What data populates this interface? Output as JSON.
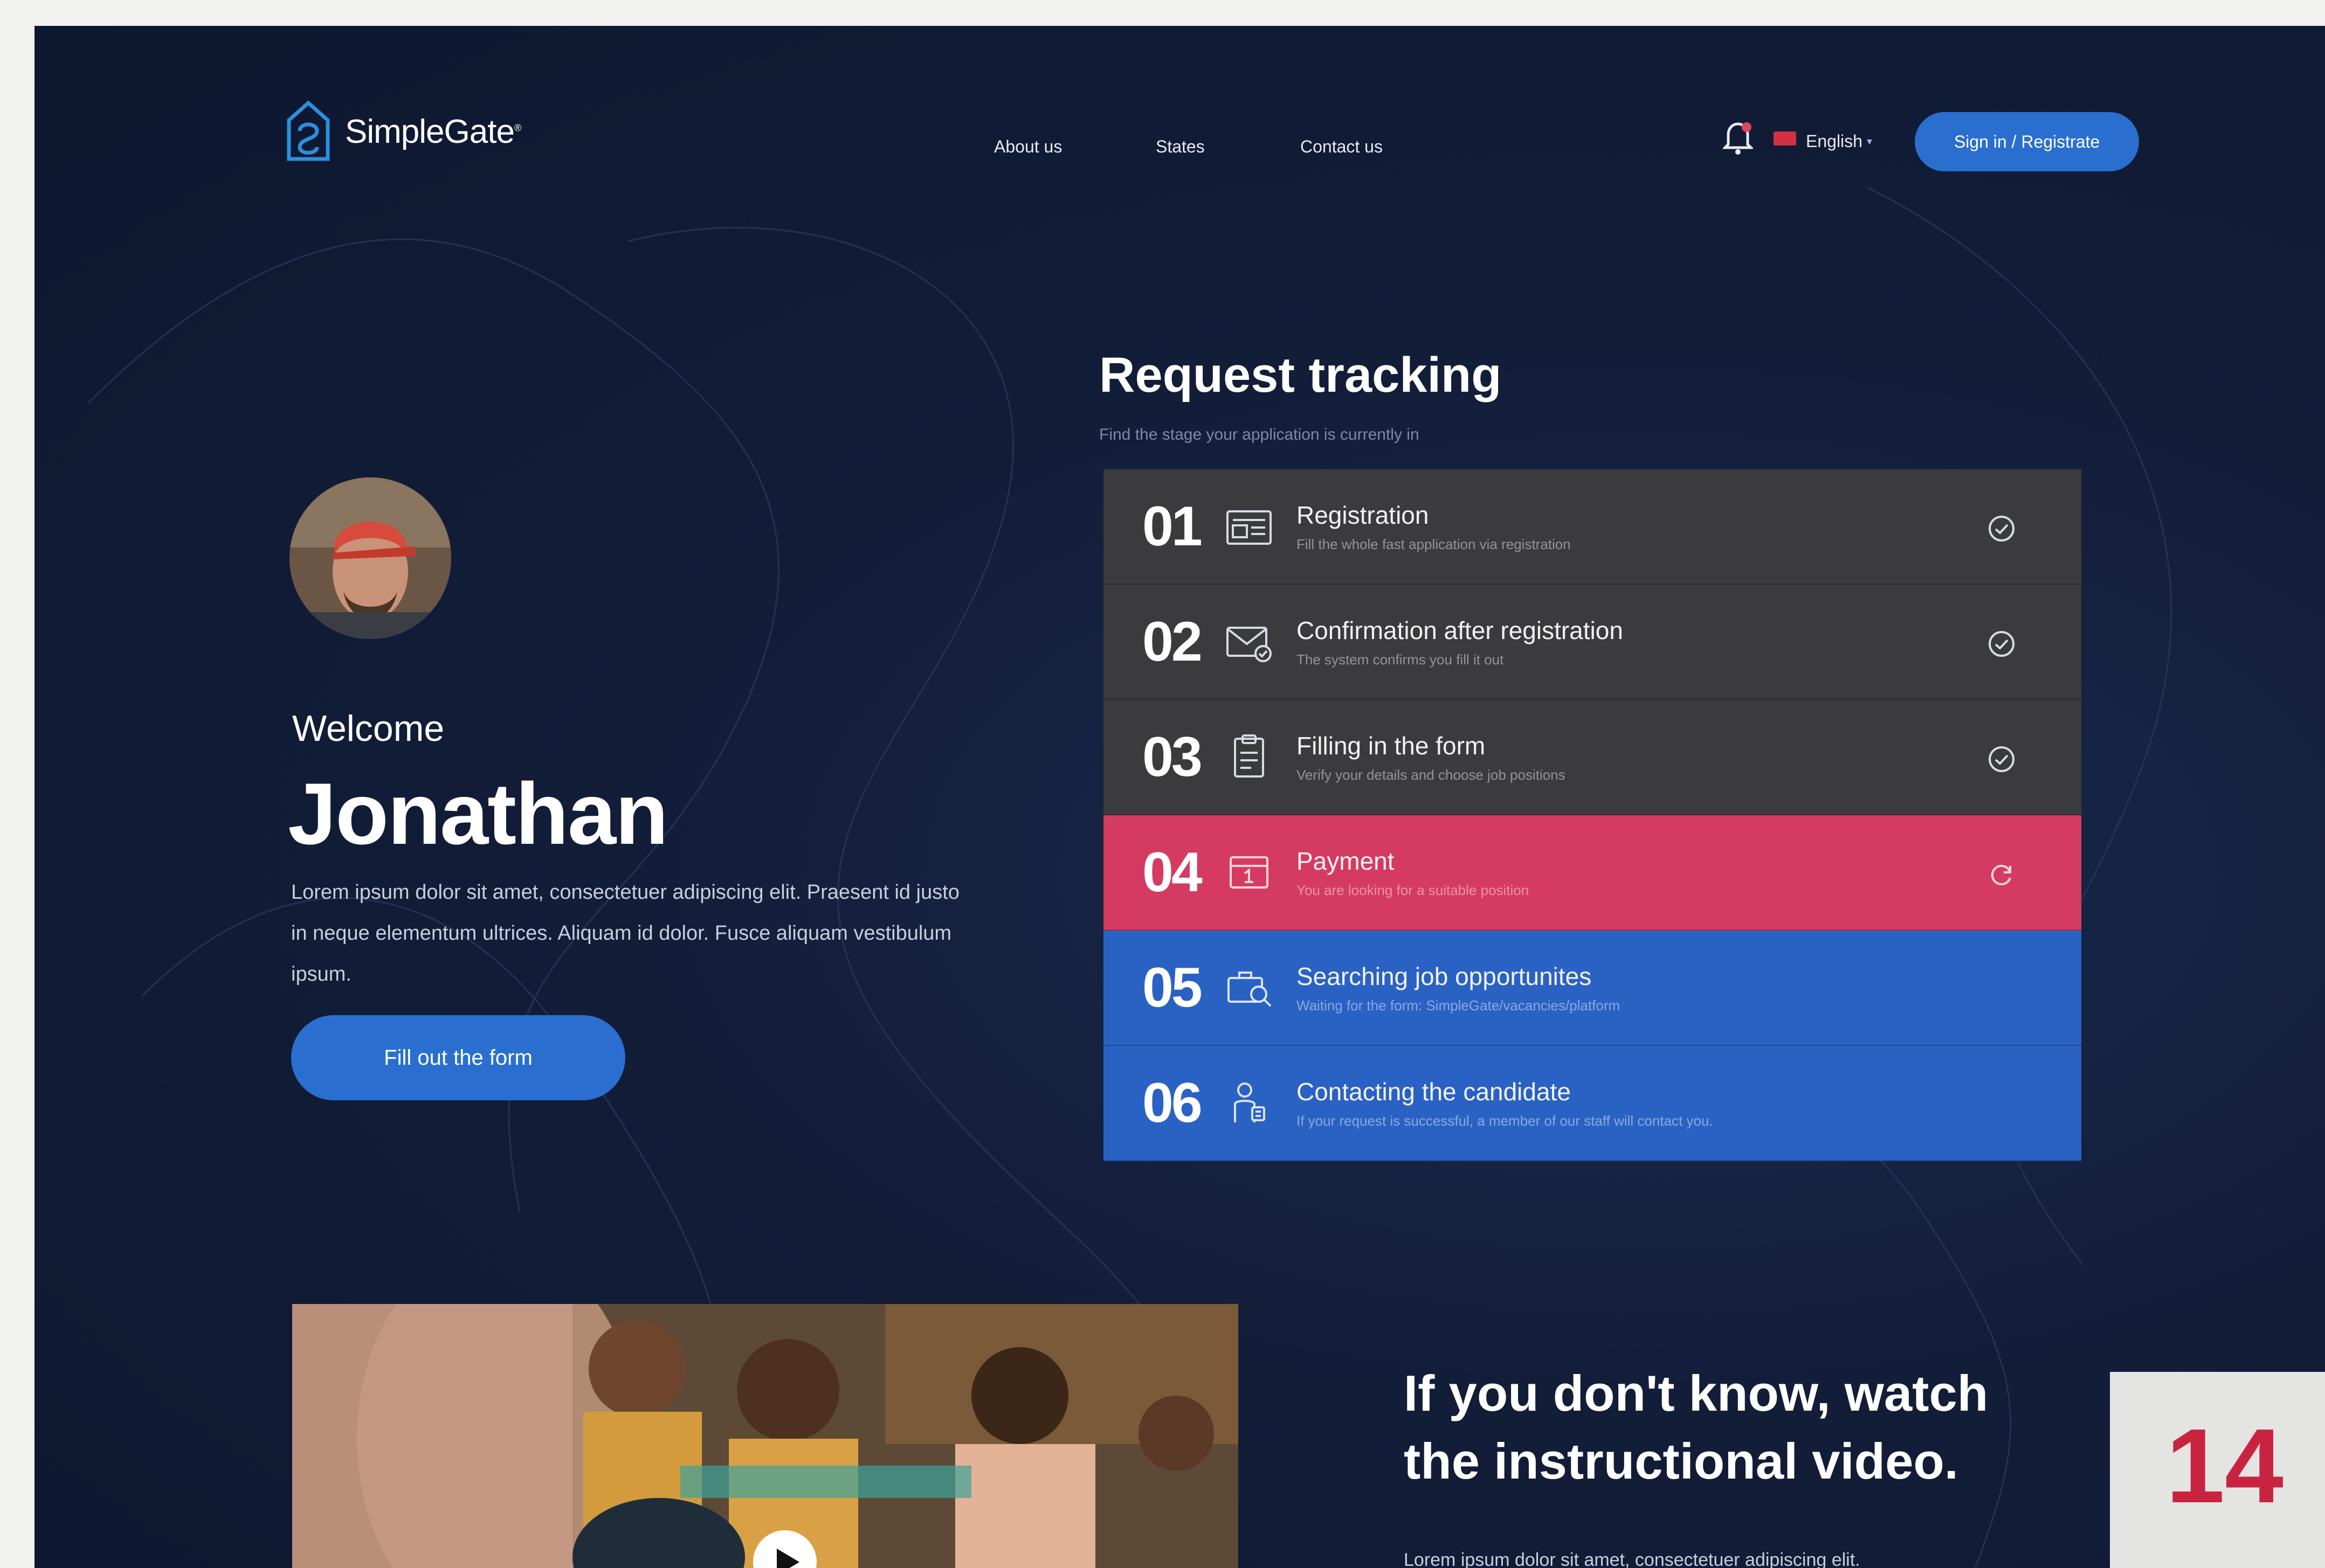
{
  "brand": {
    "name": "SimpleGate",
    "trademark": "®"
  },
  "nav": {
    "items": [
      "About us",
      "States",
      "Contact us"
    ],
    "language": "English",
    "signin_label": "Sign in / Registrate"
  },
  "hero": {
    "welcome": "Welcome",
    "username": "Jonathan",
    "intro": "Lorem ipsum dolor sit amet, consectetuer adipiscing elit. Praesent id justo in neque elementum ultrices. Aliquam id dolor. Fusce aliquam vestibulum ipsum.",
    "cta_label": "Fill out the form"
  },
  "tracking": {
    "title": "Request tracking",
    "subtitle": "Find the stage your application is currently in",
    "steps": [
      {
        "number": "01",
        "title": "Registration",
        "desc": "Fill the whole fast application via registration",
        "state": "done",
        "icon": "registration-icon"
      },
      {
        "number": "02",
        "title": "Confirmation after registration",
        "desc": "The system confirms you fill it out",
        "state": "done",
        "icon": "mail-icon"
      },
      {
        "number": "03",
        "title": "Filling in the form",
        "desc": "Verify your details and choose job positions",
        "state": "done",
        "icon": "form-icon"
      },
      {
        "number": "04",
        "title": "Payment",
        "desc": "You are looking for a suitable position",
        "state": "current",
        "icon": "payment-icon"
      },
      {
        "number": "05",
        "title": "Searching job opportunites",
        "desc": "Waiting for the form: SimpleGate/vacancies/platform",
        "state": "pending",
        "icon": "job-search-icon"
      },
      {
        "number": "06",
        "title": "Contacting the candidate",
        "desc": "If your request is successful, a member of our staff will contact you.",
        "state": "pending",
        "icon": "candidate-icon"
      }
    ],
    "colors": {
      "done": "#3b3b3d",
      "current": "#d53b62",
      "pending": "#2a62c4"
    }
  },
  "video": {
    "title": "If you don't know, watch the instructional video.",
    "body": "Lorem ipsum dolor sit amet, consectetuer adipiscing elit."
  },
  "page_number": "14"
}
